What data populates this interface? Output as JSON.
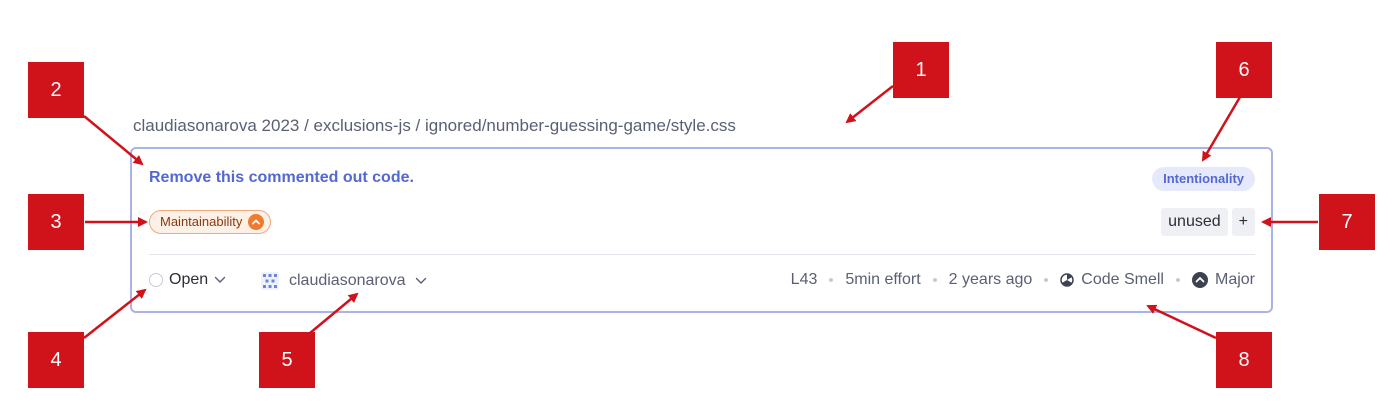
{
  "breadcrumb": "claudiasonarova 2023 / exclusions-js / ignored/number-guessing-game/style.css",
  "issue": {
    "title": "Remove this commented out code.",
    "clean_code_attribute": "Intentionality",
    "software_quality": "Maintainability",
    "software_quality_severity_icon": "chevron-up-icon",
    "tags": [
      "unused"
    ],
    "add_tag_label": "+",
    "status": "Open",
    "assignee": "claudiasonarova",
    "line": "L43",
    "effort": "5min effort",
    "age": "2 years ago",
    "type": "Code Smell",
    "severity": "Major"
  },
  "annotations": [
    "1",
    "2",
    "3",
    "4",
    "5",
    "6",
    "7",
    "8"
  ],
  "colors": {
    "accent": "#5468d4",
    "card_border": "#a9b3e6",
    "quality_orange": "#f07a2d",
    "marker_red": "#d0121b"
  }
}
